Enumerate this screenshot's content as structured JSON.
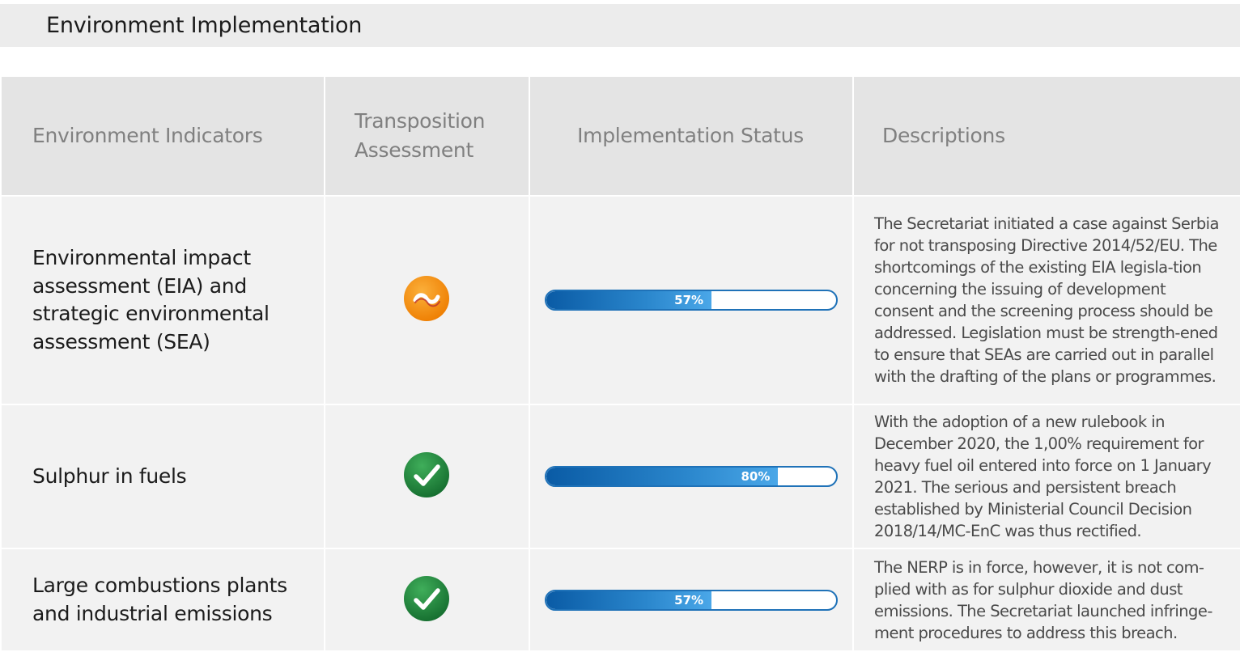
{
  "page_title": "Environment Implementation",
  "columns": {
    "indicators": "Environment Indicators",
    "transposition": "Transposition Assessment",
    "implementation": "Implementation Status",
    "descriptions": "Descriptions"
  },
  "rows": [
    {
      "indicator": "Environmental impact assessment (EIA) and strategic environmental assessment (SEA)",
      "transposition_icon": "partial-tilde-icon",
      "transposition_color": "#f39200",
      "implementation_percent": 57,
      "implementation_label": "57%",
      "description": "The Secretariat initiated a case against Serbia for not transposing Directive 2014/52/EU. The shortcomings of the existing EIA legisla-tion concerning the issuing of development consent and the screening process should be addressed. Legislation must be strength-ened to ensure that SEAs are carried out in parallel with the drafting of the plans or programmes."
    },
    {
      "indicator": "Sulphur in fuels",
      "transposition_icon": "checkmark-icon",
      "transposition_color": "#1e8a3c",
      "implementation_percent": 80,
      "implementation_label": "80%",
      "description": "With the adoption of a new rulebook in December 2020, the 1,00% requirement for heavy fuel oil entered into force on 1 January 2021. The serious and persistent breach established by Ministerial Council Decision 2018/14/MC-EnC was thus rectified."
    },
    {
      "indicator": "Large combustions plants and industrial emissions",
      "transposition_icon": "checkmark-icon",
      "transposition_color": "#1e8a3c",
      "implementation_percent": 57,
      "implementation_label": "57%",
      "description": "The NERP is in force, however, it is not com-plied with as for sulphur dioxide and dust emissions. The Secretariat launched infringe-ment procedures to address this breach."
    }
  ]
}
